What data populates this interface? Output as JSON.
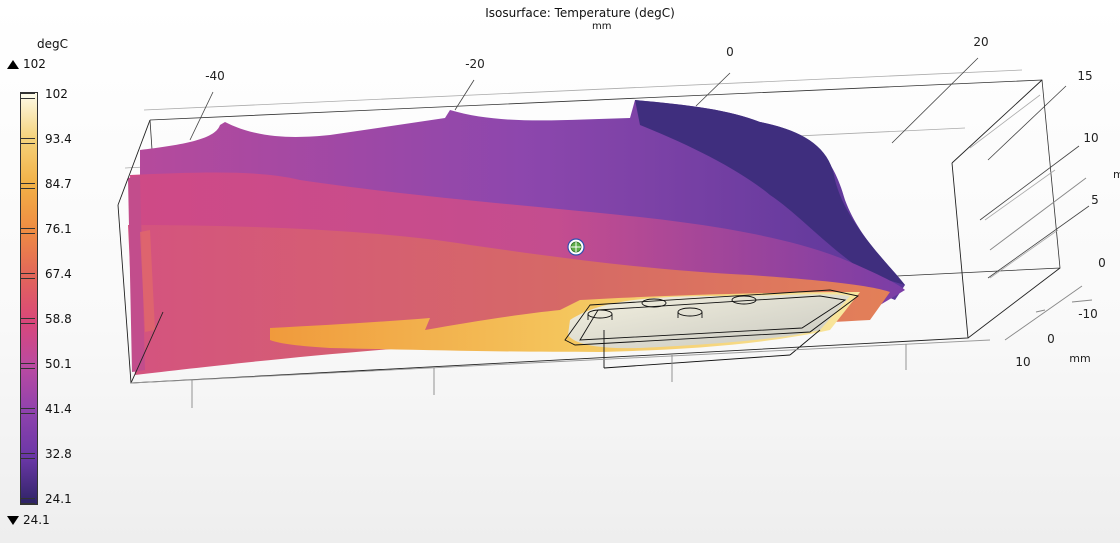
{
  "chart_data": {
    "type": "isosurface-3d",
    "title": "Isosurface: Temperature (degC)",
    "x_axis": {
      "unit": "mm",
      "ticks": [
        "-40",
        "-20",
        "0",
        "20"
      ]
    },
    "y_axis": {
      "unit": "mm",
      "ticks": [
        "15",
        "10",
        "5",
        "0",
        "-10"
      ]
    },
    "z_axis": {
      "unit": "mm",
      "ticks": [
        "0",
        "10"
      ]
    },
    "y_axis_unit_visible": "m",
    "color_legend": {
      "unit": "degC",
      "max": "102",
      "min": "24.1",
      "levels": [
        {
          "value": "102",
          "color": "#fdfbe8"
        },
        {
          "value": "93.4",
          "color": "#f5d27a"
        },
        {
          "value": "84.7",
          "color": "#f2b046"
        },
        {
          "value": "76.1",
          "color": "#ef8c43"
        },
        {
          "value": "67.4",
          "color": "#e2665a"
        },
        {
          "value": "58.8",
          "color": "#d9477a"
        },
        {
          "value": "50.1",
          "color": "#b94aa2"
        },
        {
          "value": "41.4",
          "color": "#8e42ad"
        },
        {
          "value": "32.8",
          "color": "#6a37a6"
        },
        {
          "value": "24.1",
          "color": "#2f2466"
        }
      ]
    }
  }
}
